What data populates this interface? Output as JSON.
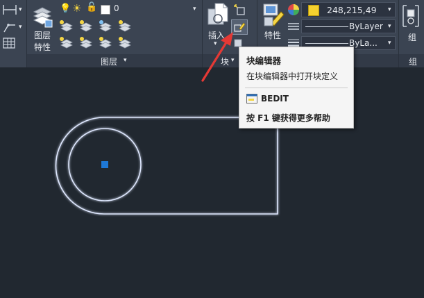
{
  "ribbon": {
    "layer_panel": {
      "button_label_line1": "图层",
      "button_label_line2": "特性",
      "current_layer": "0",
      "title": "图层"
    },
    "block_panel": {
      "insert_label": "插入",
      "title": "块"
    },
    "properties_panel": {
      "button_label": "特性",
      "color_value": "248,215,49",
      "linetype": "ByLayer",
      "lineweight": "ByLa...",
      "color_swatch": "#f5d12f"
    },
    "group_panel": {
      "button_label": "组",
      "title": "组"
    }
  },
  "tooltip": {
    "title": "块编辑器",
    "description": "在块编辑器中打开块定义",
    "command": "BEDIT",
    "help": "按 F1 键获得更多帮助"
  },
  "colors": {
    "ribbon": "#3b4452",
    "canvas": "#212830",
    "geometry": "#dfe8ff",
    "arrow": "#e53935",
    "center_marker": "#1e78d6"
  }
}
